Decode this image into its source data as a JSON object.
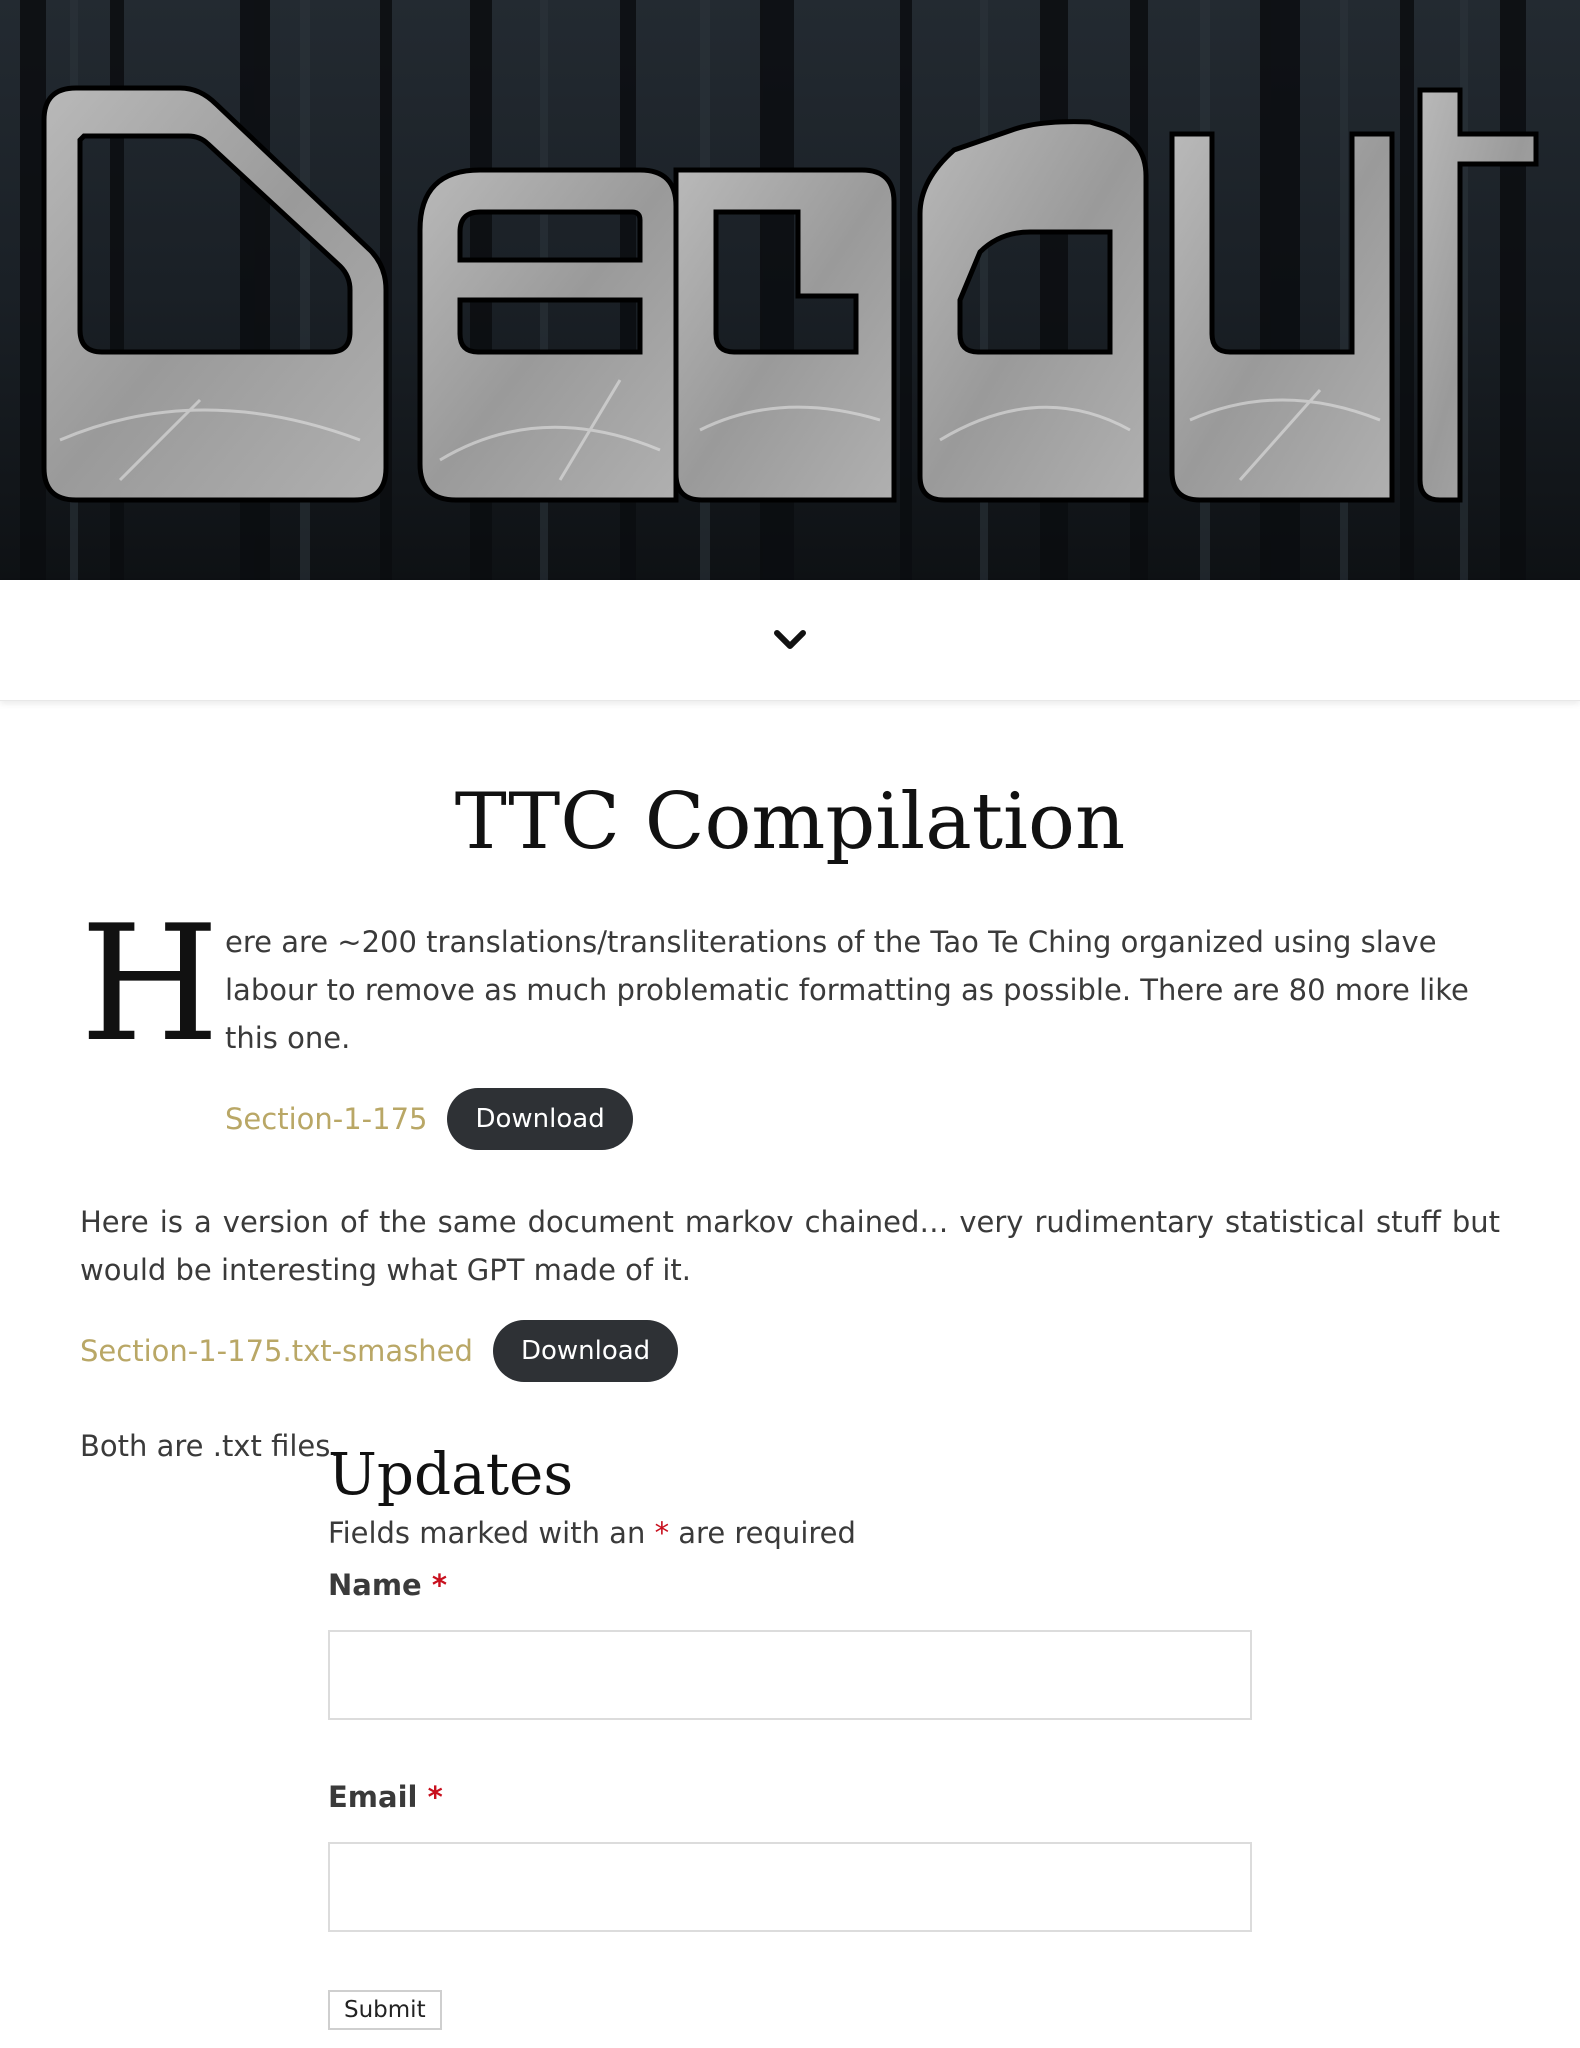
{
  "hero": {
    "logo_text": "Decaut"
  },
  "nav": {
    "toggle_icon": "chevron-down-icon"
  },
  "main": {
    "title": "TTC Compilation",
    "dropcap": "H",
    "intro_text": "ere are ~200 translations/transliterations of the Tao Te Ching organized using slave labour to remove as much problematic formatting as possible. There are 80 more like this one.",
    "file1": {
      "name": "Section-1-175",
      "button": "Download"
    },
    "paragraph2": "Here is a version of the same document markov chained… very rudimentary statistical stuff but would be interesting what GPT made of it.",
    "file2": {
      "name": "Section-1-175.txt-smashed",
      "button": "Download"
    },
    "paragraph3": "Both are .txt files."
  },
  "form": {
    "title": "Updates",
    "required_note_before": "Fields marked with an ",
    "required_star": "*",
    "required_note_after": " are required",
    "name_label": "Name",
    "email_label": "Email",
    "name_value": "",
    "email_value": "",
    "submit_label": "Submit"
  },
  "colors": {
    "link": "#b9a766",
    "button_bg": "#2e3135",
    "required": "#c8101e"
  }
}
